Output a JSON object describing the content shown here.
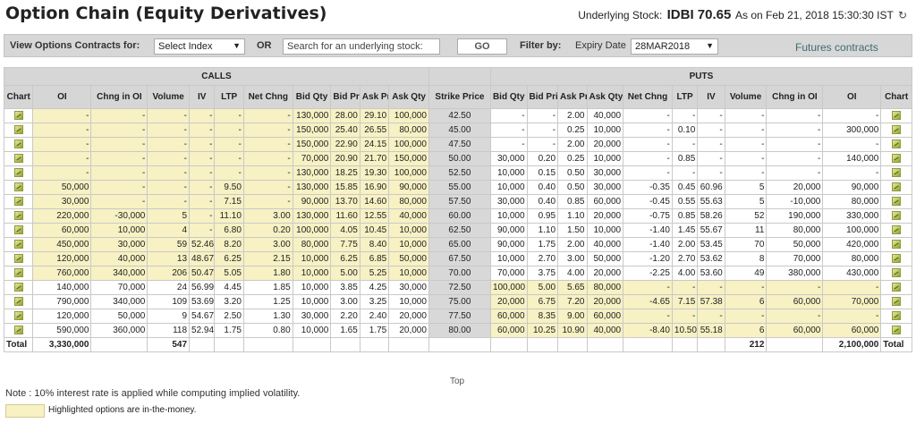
{
  "header": {
    "title": "Option Chain (Equity Derivatives)",
    "underlying_label": "Underlying Stock:",
    "underlying_stock": "IDBI 70.65",
    "as_on": "As on Feb 21, 2018 15:30:30 IST",
    "refresh_icon": "refresh-icon"
  },
  "filters": {
    "view_label": "View Options Contracts for:",
    "index_select": "Select Index",
    "or_label": "OR",
    "search_placeholder": "Search for an underlying stock:",
    "go_label": "GO",
    "filter_by_label": "Filter by:",
    "expiry_label": "Expiry Date",
    "expiry_value": "28MAR2018",
    "futures_link": "Futures contracts"
  },
  "table": {
    "calls_label": "CALLS",
    "puts_label": "PUTS",
    "call_columns": [
      "Chart",
      "OI",
      "Chng in OI",
      "Volume",
      "IV",
      "LTP",
      "Net Chng",
      "Bid Qty",
      "Bid Price",
      "Ask Price",
      "Ask Qty"
    ],
    "strike_column": "Strike Price",
    "put_columns": [
      "Bid Qty",
      "Bid Price",
      "Ask Price",
      "Ask Qty",
      "Net Chng",
      "LTP",
      "IV",
      "Volume",
      "Chng in OI",
      "OI",
      "Chart"
    ],
    "rows": [
      {
        "call": [
          "-",
          "-",
          "-",
          "-",
          "-",
          "-",
          "130,000",
          "28.00",
          "29.10",
          "100,000"
        ],
        "strike": "42.50",
        "put": [
          "-",
          "-",
          "2.00",
          "40,000",
          "-",
          "-",
          "-",
          "-",
          "-",
          "-"
        ],
        "call_itm": true,
        "put_itm": false
      },
      {
        "call": [
          "-",
          "-",
          "-",
          "-",
          "-",
          "-",
          "150,000",
          "25.40",
          "26.55",
          "80,000"
        ],
        "strike": "45.00",
        "put": [
          "-",
          "-",
          "0.25",
          "10,000",
          "-",
          "0.10",
          "-",
          "-",
          "-",
          "300,000"
        ],
        "call_itm": true,
        "put_itm": false
      },
      {
        "call": [
          "-",
          "-",
          "-",
          "-",
          "-",
          "-",
          "150,000",
          "22.90",
          "24.15",
          "100,000"
        ],
        "strike": "47.50",
        "put": [
          "-",
          "-",
          "2.00",
          "20,000",
          "-",
          "-",
          "-",
          "-",
          "-",
          "-"
        ],
        "call_itm": true,
        "put_itm": false
      },
      {
        "call": [
          "-",
          "-",
          "-",
          "-",
          "-",
          "-",
          "70,000",
          "20.90",
          "21.70",
          "150,000"
        ],
        "strike": "50.00",
        "put": [
          "30,000",
          "0.20",
          "0.25",
          "10,000",
          "-",
          "0.85",
          "-",
          "-",
          "-",
          "140,000"
        ],
        "call_itm": true,
        "put_itm": false
      },
      {
        "call": [
          "-",
          "-",
          "-",
          "-",
          "-",
          "-",
          "130,000",
          "18.25",
          "19.30",
          "100,000"
        ],
        "strike": "52.50",
        "put": [
          "10,000",
          "0.15",
          "0.50",
          "30,000",
          "-",
          "-",
          "-",
          "-",
          "-",
          "-"
        ],
        "call_itm": true,
        "put_itm": false
      },
      {
        "call": [
          "50,000",
          "-",
          "-",
          "-",
          "9.50",
          "-",
          "130,000",
          "15.85",
          "16.90",
          "90,000"
        ],
        "strike": "55.00",
        "put": [
          "10,000",
          "0.40",
          "0.50",
          "30,000",
          "-0.35",
          "0.45",
          "60.96",
          "5",
          "20,000",
          "90,000"
        ],
        "call_itm": true,
        "put_itm": false
      },
      {
        "call": [
          "30,000",
          "-",
          "-",
          "-",
          "7.15",
          "-",
          "90,000",
          "13.70",
          "14.60",
          "80,000"
        ],
        "strike": "57.50",
        "put": [
          "30,000",
          "0.40",
          "0.85",
          "60,000",
          "-0.45",
          "0.55",
          "55.63",
          "5",
          "-10,000",
          "80,000"
        ],
        "call_itm": true,
        "put_itm": false
      },
      {
        "call": [
          "220,000",
          "-30,000",
          "5",
          "-",
          "11.10",
          "3.00",
          "130,000",
          "11.60",
          "12.55",
          "40,000"
        ],
        "strike": "60.00",
        "put": [
          "10,000",
          "0.95",
          "1.10",
          "20,000",
          "-0.75",
          "0.85",
          "58.26",
          "52",
          "190,000",
          "330,000"
        ],
        "call_itm": true,
        "put_itm": false
      },
      {
        "call": [
          "60,000",
          "10,000",
          "4",
          "-",
          "6.80",
          "0.20",
          "100,000",
          "4.05",
          "10.45",
          "10,000"
        ],
        "strike": "62.50",
        "put": [
          "90,000",
          "1.10",
          "1.50",
          "10,000",
          "-1.40",
          "1.45",
          "55.67",
          "11",
          "80,000",
          "100,000"
        ],
        "call_itm": true,
        "put_itm": false
      },
      {
        "call": [
          "450,000",
          "30,000",
          "59",
          "52.46",
          "8.20",
          "3.00",
          "80,000",
          "7.75",
          "8.40",
          "10,000"
        ],
        "strike": "65.00",
        "put": [
          "90,000",
          "1.75",
          "2.00",
          "40,000",
          "-1.40",
          "2.00",
          "53.45",
          "70",
          "50,000",
          "420,000"
        ],
        "call_itm": true,
        "put_itm": false
      },
      {
        "call": [
          "120,000",
          "40,000",
          "13",
          "48.67",
          "6.25",
          "2.15",
          "10,000",
          "6.25",
          "6.85",
          "50,000"
        ],
        "strike": "67.50",
        "put": [
          "10,000",
          "2.70",
          "3.00",
          "50,000",
          "-1.20",
          "2.70",
          "53.62",
          "8",
          "70,000",
          "80,000"
        ],
        "call_itm": true,
        "put_itm": false
      },
      {
        "call": [
          "760,000",
          "340,000",
          "206",
          "50.47",
          "5.05",
          "1.80",
          "10,000",
          "5.00",
          "5.25",
          "10,000"
        ],
        "strike": "70.00",
        "put": [
          "70,000",
          "3.75",
          "4.00",
          "20,000",
          "-2.25",
          "4.00",
          "53.60",
          "49",
          "380,000",
          "430,000"
        ],
        "call_itm": true,
        "put_itm": false
      },
      {
        "call": [
          "140,000",
          "70,000",
          "24",
          "56.99",
          "4.45",
          "1.85",
          "10,000",
          "3.85",
          "4.25",
          "30,000"
        ],
        "strike": "72.50",
        "put": [
          "100,000",
          "5.00",
          "5.65",
          "80,000",
          "-",
          "-",
          "-",
          "-",
          "-",
          "-"
        ],
        "call_itm": false,
        "put_itm": true
      },
      {
        "call": [
          "790,000",
          "340,000",
          "109",
          "53.69",
          "3.20",
          "1.25",
          "10,000",
          "3.00",
          "3.25",
          "10,000"
        ],
        "strike": "75.00",
        "put": [
          "20,000",
          "6.75",
          "7.20",
          "20,000",
          "-4.65",
          "7.15",
          "57.38",
          "6",
          "60,000",
          "70,000"
        ],
        "call_itm": false,
        "put_itm": true
      },
      {
        "call": [
          "120,000",
          "50,000",
          "9",
          "54.67",
          "2.50",
          "1.30",
          "30,000",
          "2.20",
          "2.40",
          "20,000"
        ],
        "strike": "77.50",
        "put": [
          "60,000",
          "8.35",
          "9.00",
          "60,000",
          "-",
          "-",
          "-",
          "-",
          "-",
          "-"
        ],
        "call_itm": false,
        "put_itm": true
      },
      {
        "call": [
          "590,000",
          "360,000",
          "118",
          "52.94",
          "1.75",
          "0.80",
          "10,000",
          "1.65",
          "1.75",
          "20,000"
        ],
        "strike": "80.00",
        "put": [
          "60,000",
          "10.25",
          "10.90",
          "40,000",
          "-8.40",
          "10.50",
          "55.18",
          "6",
          "60,000",
          "60,000"
        ],
        "call_itm": false,
        "put_itm": true
      }
    ],
    "totals": {
      "label": "Total",
      "call_oi": "3,330,000",
      "call_volume": "547",
      "put_volume": "212",
      "put_oi": "2,100,000",
      "right_label": "Total"
    }
  },
  "footer": {
    "top_link": "Top",
    "note": "Note : 10% interest rate is applied while computing implied volatility.",
    "legend": "Highlighted options are in-the-money."
  },
  "colors": {
    "itm": "#f7f1c3",
    "header_bg": "#d6d6d6",
    "strike_bg": "#d8d8d8",
    "futures_link": "#3d6c6f"
  }
}
